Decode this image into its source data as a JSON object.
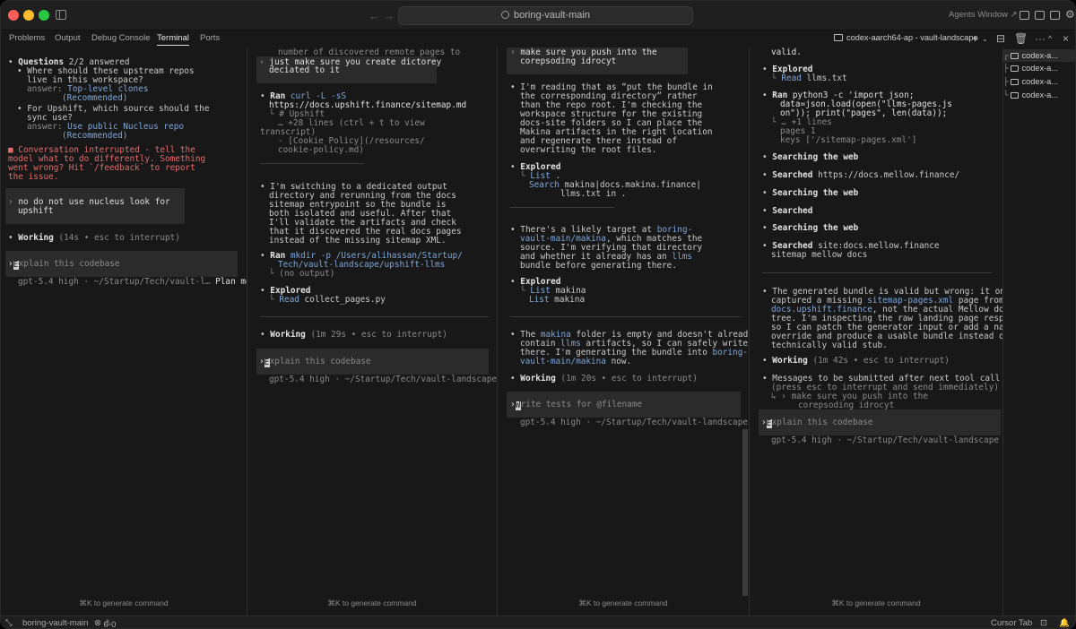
{
  "window": {
    "title": "boring-vault-main",
    "agents_label": "Agents Window"
  },
  "panel_tabs": [
    "Problems",
    "Output",
    "Debug Console",
    "Terminal",
    "Ports"
  ],
  "active_terminal": "codex-aarch64-ap - vault-landscape",
  "terminal_list": [
    "codex-a...",
    "codex-a...",
    "codex-a...",
    "codex-a..."
  ],
  "generate_hint": "⌘K to generate command",
  "statusbar": {
    "branch": "boring-vault-main",
    "errors": "0",
    "warnings": "0",
    "cursor_tab": "Cursor Tab"
  },
  "pane1": {
    "q_title": "Questions",
    "q_count": "2/2 answered",
    "q1a": "Where should these upstream repos",
    "q1b": "live in this workspace?",
    "q1_ans_label": "answer:",
    "q1_ans": "Top-level clones",
    "q1_rec": "(Recommended)",
    "q2a": "For Upshift, which source should the",
    "q2b": "sync use?",
    "q2_ans_label": "answer:",
    "q2_ans": "Use public Nucleus repo",
    "q2_rec": "(Recommended)",
    "int1": "Conversation interrupted - tell the",
    "int2": "model what to do differently. Something",
    "int3": "went wrong? Hit `/feedback` to report",
    "int4": "the issue.",
    "user1": "no do not use nucleus look for",
    "user2": "upshift",
    "working": "Working",
    "working_meta": "(14s • esc to interrupt)",
    "prompt": "xplain this codebase",
    "prompt_first": "E",
    "footer": "gpt-5.4 high · ~/Startup/Tech/vault-l…",
    "mode": "Plan mode"
  },
  "pane2": {
    "top1": "number of discovered remote pages to",
    "user1": "just make sure you create dictorey",
    "user2": "deciated to it",
    "ran1_label": "Ran",
    "ran1_cmd": "curl -L -sS",
    "ran1_url": "https://docs.upshift.finance/sitemap.md",
    "ran1_o1": "# Upshift",
    "ran1_o2": "… +28 lines (ctrl + t to view",
    "ran1_o3": "transcript)",
    "ran1_o4": "- [Cookie Policy](/resources/",
    "ran1_o5": "cookie-policy.md)",
    "msg1": "I'm switching to a dedicated output",
    "msg2": "directory and rerunning from the docs",
    "msg3": "sitemap entrypoint so the bundle is",
    "msg4": "both isolated and useful. After that",
    "msg5": "I'll validate the artifacts and check",
    "msg6": "that it discovered the real docs pages",
    "msg7": "instead of the missing sitemap XML.",
    "ran2_label": "Ran",
    "ran2_cmd": "mkdir -p /Users/alihassan/Startup/",
    "ran2_cmd2": "Tech/vault-landscape/upshift-llms",
    "ran2_o1": "(no output)",
    "exp_label": "Explored",
    "exp_read": "Read",
    "exp_file": "collect_pages.py",
    "working": "Working",
    "working_meta": "(1m 29s • esc to interrupt)",
    "prompt": "xplain this codebase",
    "prompt_first": "E",
    "footer": "gpt-5.4 high · ~/Startup/Tech/vault-landscape"
  },
  "pane3": {
    "user1": "make sure you push into the",
    "user2": "corepsoding idrocyt",
    "msg1": "I'm reading that as “put the bundle in",
    "msg2": "the corresponding directory” rather",
    "msg3": "than the repo root. I'm checking the",
    "msg4": "workspace structure for the existing",
    "msg5": "docs-site folders so I can place the",
    "msg6": "Makina artifacts in the right location",
    "msg7": "and regenerate there instead of",
    "msg8": "overwriting the root files.",
    "exp1_label": "Explored",
    "exp1_list": "List",
    "exp1_list_v": ".",
    "exp1_search": "Search",
    "exp1_search_v": "makina|docs.makina.finance|",
    "exp1_search_v2": "llms.txt in .",
    "msg9a": "There's a likely target at ",
    "msg9b": "boring-",
    "msg10a": "vault-main/makina",
    "msg10b": ", which matches the",
    "msg11": "source. I'm verifying that directory",
    "msg12": "and whether it already has an ",
    "msg12b": "llms",
    "msg13": "bundle before generating there.",
    "exp2_label": "Explored",
    "exp2_list1": "List",
    "exp2_v1": "makina",
    "exp2_list2": "List",
    "exp2_v2": "makina",
    "msg14a": "The ",
    "msg14b": "makina",
    "msg14c": " folder is empty and doesn't already",
    "msg15a": "contain ",
    "msg15b": "llms",
    "msg15c": " artifacts, so I can safely write",
    "msg16a": "there. I'm generating the bundle into ",
    "msg16b": "boring-",
    "msg17a": "vault-main/makina",
    "msg17b": " now.",
    "working": "Working",
    "working_meta": "(1m 20s • esc to interrupt)",
    "prompt": "rite tests for @filename",
    "prompt_first": "W",
    "footer": "gpt-5.4 high · ~/Startup/Tech/vault-landscape"
  },
  "pane4": {
    "top1": "valid.",
    "exp1_label": "Explored",
    "exp1_read": "Read",
    "exp1_file": "llms.txt",
    "ran_label": "Ran",
    "ran_cmd1": "python3 -c 'import json;",
    "ran_cmd2": "data=json.load(open(\"llms-pages.js",
    "ran_cmd3": "on\")); print(\"pages\", len(data));",
    "ran_o1": "… +1 lines",
    "ran_o2": "pages 1",
    "ran_o3": "keys ['/sitemap-pages.xml']",
    "s1": "Searching the web",
    "s2_label": "Searched",
    "s2_v": "https://docs.mellow.finance/",
    "s3": "Searching the web",
    "s4": "Searched",
    "s5": "Searching the web",
    "s6_label": "Searched",
    "s6_v": "site:docs.mellow.finance",
    "s6_v2": "sitemap mellow docs",
    "msg1": "The generated bundle is valid but wrong: it only",
    "msg2a": "captured a missing ",
    "msg2b": "sitemap-pages.xml",
    "msg2c": " page from",
    "msg3a": "docs.upshift.finance",
    "msg3b": ", not the actual Mellow docs",
    "msg4": "tree. I'm inspecting the raw landing page response",
    "msg5": "so I can patch the generator input or add a narrow",
    "msg6": "override and produce a usable bundle instead of a",
    "msg7": "technically valid stub.",
    "working": "Working",
    "working_meta": "(1m 42s • esc to interrupt)",
    "queue1": "Messages to be submitted after next tool call",
    "queue2": "(press esc to interrupt and send immediately)",
    "queue3": "↳ › make sure you push into the",
    "queue4": "corepsoding idrocyt",
    "prompt": "xplain this codebase",
    "prompt_first": "E",
    "footer": "gpt-5.4 high · ~/Startup/Tech/vault-landscape"
  }
}
